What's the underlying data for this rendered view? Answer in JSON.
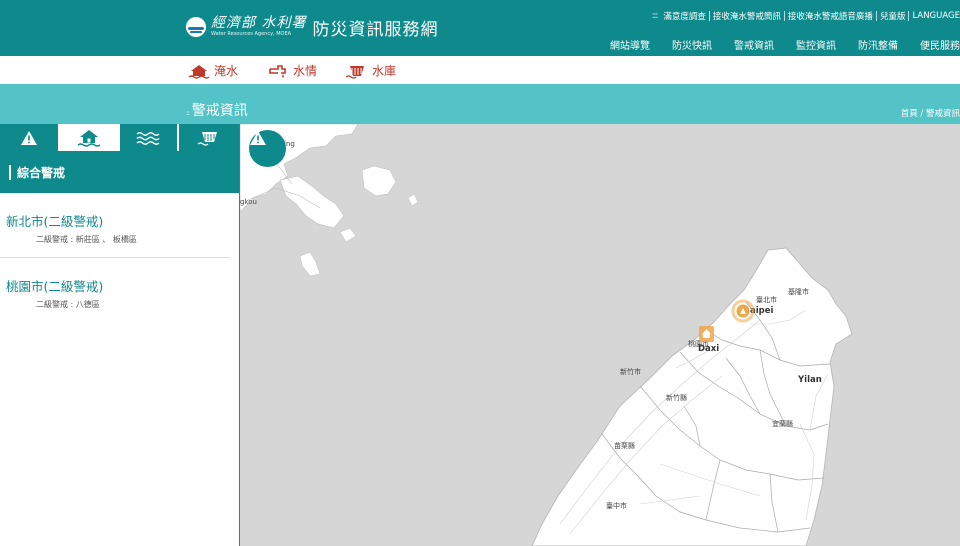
{
  "header": {
    "ministry": "經濟部",
    "agency": "水利署",
    "agency_en": "Water Resources Agency, MOEA",
    "site_title": "防災資訊服務網",
    "top_links": [
      "滿意度調查",
      "接收淹水警戒簡訊",
      "接收淹水警戒語音廣播",
      "兒童版",
      "LANGUAGE"
    ],
    "nav": [
      "網站導覽",
      "防災快訊",
      "警戒資訊",
      "監控資訊",
      "防汛整備",
      "便民服務"
    ]
  },
  "subnav": [
    {
      "label": "淹水",
      "icon": "flood-house-icon"
    },
    {
      "label": "水情",
      "icon": "water-faucet-icon"
    },
    {
      "label": "水庫",
      "icon": "reservoir-dam-icon"
    }
  ],
  "banner": {
    "title": "警戒資訊",
    "breadcrumb": "首頁 / 警戒資訊"
  },
  "sidebar": {
    "tabs": [
      {
        "icon": "warning-icon",
        "active": false
      },
      {
        "icon": "flood-house-icon",
        "active": true
      },
      {
        "icon": "waves-icon",
        "active": false
      },
      {
        "icon": "reservoir-dam-icon",
        "active": false
      }
    ],
    "panel_title": "綜合警戒",
    "alerts": [
      {
        "city": "新北市(二級警戒)",
        "detail": "二級警戒 : 新莊區 、 板橋區"
      },
      {
        "city": "桃園市(二級警戒)",
        "detail": "二級警戒 : 八德區"
      }
    ]
  },
  "map": {
    "labels": [
      {
        "id": "fuzhou-partial",
        "text": "ing"
      },
      {
        "id": "mawei-partial",
        "text": "gkou"
      },
      {
        "id": "taipei-zh",
        "text": "臺北市"
      },
      {
        "id": "keelung-zh",
        "text": "基隆市"
      },
      {
        "id": "taipei-en",
        "text": "aipei"
      },
      {
        "id": "taoyuan-zh",
        "text": "桃園市"
      },
      {
        "id": "daxi-en",
        "text": "Daxi"
      },
      {
        "id": "hsinchu-city",
        "text": "新竹市"
      },
      {
        "id": "hsinchu-county",
        "text": "新竹縣"
      },
      {
        "id": "yilan-en",
        "text": "Yilan"
      },
      {
        "id": "yilan-zh",
        "text": "宜蘭縣"
      },
      {
        "id": "miaoli",
        "text": "苗栗縣"
      },
      {
        "id": "taichung",
        "text": "臺中市"
      }
    ],
    "markers": [
      {
        "id": "taipei-warning",
        "type": "circle-alert",
        "color": "#f0a64a"
      },
      {
        "id": "taoyuan-warning",
        "type": "house-alert",
        "color": "#f0a64a"
      }
    ]
  },
  "colors": {
    "header": "#0f8a8c",
    "banner": "#53c3c8",
    "subnav_text": "#c0392b",
    "map_bg": "#d6d6d6",
    "land": "#ffffff",
    "marker": "#f0a64a"
  }
}
